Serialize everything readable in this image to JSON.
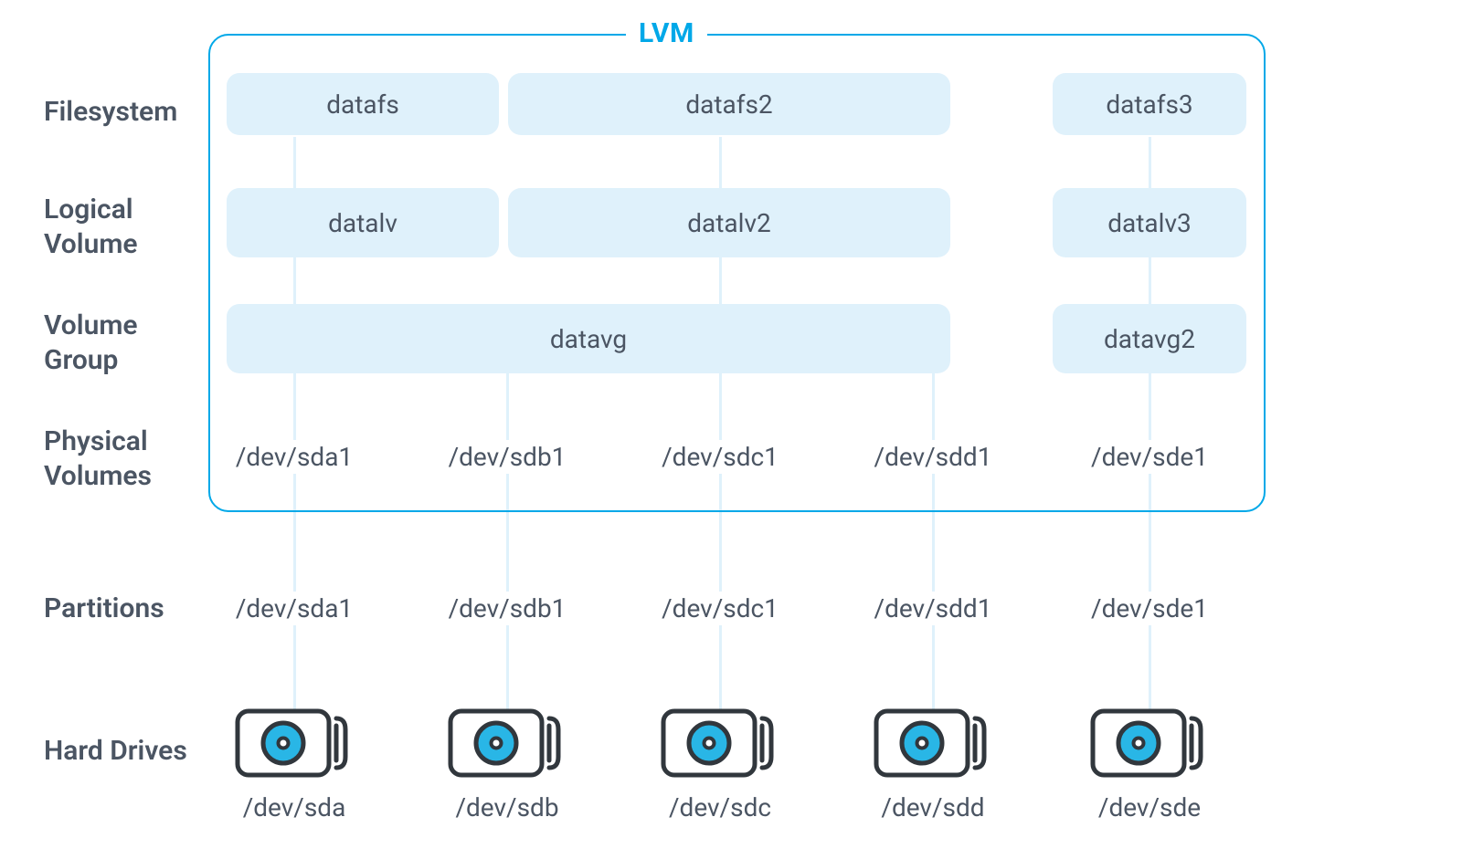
{
  "lvm_title": "LVM",
  "labels": {
    "filesystem": "Filesystem",
    "logical_volume_l1": "Logical",
    "logical_volume_l2": "Volume",
    "volume_group_l1": "Volume",
    "volume_group_l2": "Group",
    "physical_volumes_l1": "Physical",
    "physical_volumes_l2": "Volumes",
    "partitions": "Partitions",
    "hard_drives": "Hard Drives"
  },
  "filesystems": [
    "datafs",
    "datafs2",
    "datafs3"
  ],
  "logical_volumes": [
    "datalv",
    "datalv2",
    "datalv3"
  ],
  "volume_groups": [
    "datavg",
    "datavg2"
  ],
  "physical_volumes": [
    "/dev/sda1",
    "/dev/sdb1",
    "/dev/sdc1",
    "/dev/sdd1",
    "/dev/sde1"
  ],
  "partitions": [
    "/dev/sda1",
    "/dev/sdb1",
    "/dev/sdc1",
    "/dev/sdd1",
    "/dev/sde1"
  ],
  "hard_drives": [
    "/dev/sda",
    "/dev/sdb",
    "/dev/sdc",
    "/dev/sdd",
    "/dev/sde"
  ],
  "colors": {
    "accent": "#00a8e8",
    "block_bg": "#dff1fb",
    "text": "#4b5563",
    "icon_stroke": "#31373d",
    "icon_fill": "#29b6e6"
  },
  "chart_data": {
    "type": "diagram",
    "title": "LVM",
    "layers": [
      {
        "name": "Filesystem",
        "items": [
          "datafs",
          "datafs2",
          "datafs3"
        ]
      },
      {
        "name": "Logical Volume",
        "items": [
          "datalv",
          "datalv2",
          "datalv3"
        ]
      },
      {
        "name": "Volume Group",
        "items": [
          "datavg",
          "datavg2"
        ]
      },
      {
        "name": "Physical Volumes",
        "items": [
          "/dev/sda1",
          "/dev/sdb1",
          "/dev/sdc1",
          "/dev/sdd1",
          "/dev/sde1"
        ]
      },
      {
        "name": "Partitions",
        "items": [
          "/dev/sda1",
          "/dev/sdb1",
          "/dev/sdc1",
          "/dev/sdd1",
          "/dev/sde1"
        ]
      },
      {
        "name": "Hard Drives",
        "items": [
          "/dev/sda",
          "/dev/sdb",
          "/dev/sdc",
          "/dev/sdd",
          "/dev/sde"
        ]
      }
    ],
    "mappings": {
      "filesystem_to_lv": {
        "datafs": "datalv",
        "datafs2": "datalv2",
        "datafs3": "datalv3"
      },
      "lv_to_vg": {
        "datalv": "datavg",
        "datalv2": "datavg",
        "datalv3": "datavg2"
      },
      "vg_to_pv": {
        "datavg": [
          "/dev/sda1",
          "/dev/sdb1",
          "/dev/sdc1",
          "/dev/sdd1"
        ],
        "datavg2": [
          "/dev/sde1"
        ]
      },
      "pv_to_partition": {
        "/dev/sda1": "/dev/sda1",
        "/dev/sdb1": "/dev/sdb1",
        "/dev/sdc1": "/dev/sdc1",
        "/dev/sdd1": "/dev/sdd1",
        "/dev/sde1": "/dev/sde1"
      },
      "partition_to_drive": {
        "/dev/sda1": "/dev/sda",
        "/dev/sdb1": "/dev/sdb",
        "/dev/sdc1": "/dev/sdc",
        "/dev/sdd1": "/dev/sdd",
        "/dev/sde1": "/dev/sde"
      }
    }
  }
}
